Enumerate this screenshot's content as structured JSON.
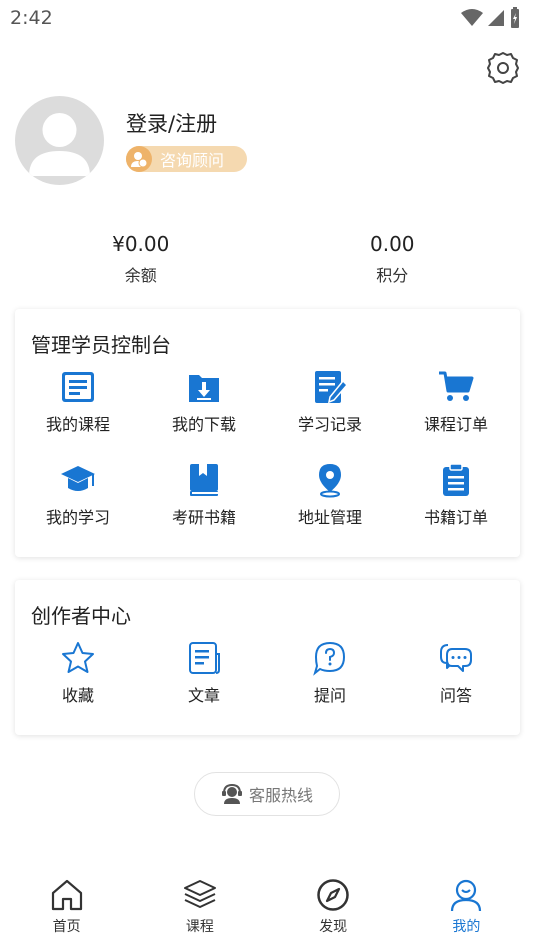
{
  "status_bar": {
    "time": "2:42"
  },
  "profile": {
    "login_label": "登录/注册",
    "consultant_label": "咨询顾问"
  },
  "stats": [
    {
      "value": "¥0.00",
      "label": "余额"
    },
    {
      "value": "0.00",
      "label": "积分"
    }
  ],
  "console": {
    "title": "管理学员控制台",
    "items": [
      {
        "label": "我的课程",
        "icon": "course-list-icon"
      },
      {
        "label": "我的下载",
        "icon": "download-folder-icon"
      },
      {
        "label": "学习记录",
        "icon": "study-record-icon"
      },
      {
        "label": "课程订单",
        "icon": "cart-icon"
      },
      {
        "label": "我的学习",
        "icon": "graduation-cap-icon"
      },
      {
        "label": "考研书籍",
        "icon": "book-icon"
      },
      {
        "label": "地址管理",
        "icon": "location-pin-icon"
      },
      {
        "label": "书籍订单",
        "icon": "clipboard-icon"
      }
    ]
  },
  "creator": {
    "title": "创作者中心",
    "items": [
      {
        "label": "收藏",
        "icon": "star-icon"
      },
      {
        "label": "文章",
        "icon": "article-icon"
      },
      {
        "label": "提问",
        "icon": "question-icon"
      },
      {
        "label": "问答",
        "icon": "chat-icon"
      }
    ]
  },
  "hotline": {
    "label": "客服热线"
  },
  "tabbar": {
    "active_color": "#1976d2",
    "items": [
      {
        "label": "首页",
        "icon": "home-icon"
      },
      {
        "label": "课程",
        "icon": "layers-icon"
      },
      {
        "label": "发现",
        "icon": "compass-icon"
      },
      {
        "label": "我的",
        "icon": "user-icon"
      }
    ]
  },
  "colors": {
    "accent": "#1976d2",
    "badge_bg": "#f5d9b0",
    "badge_icon": "#eeb36a"
  }
}
